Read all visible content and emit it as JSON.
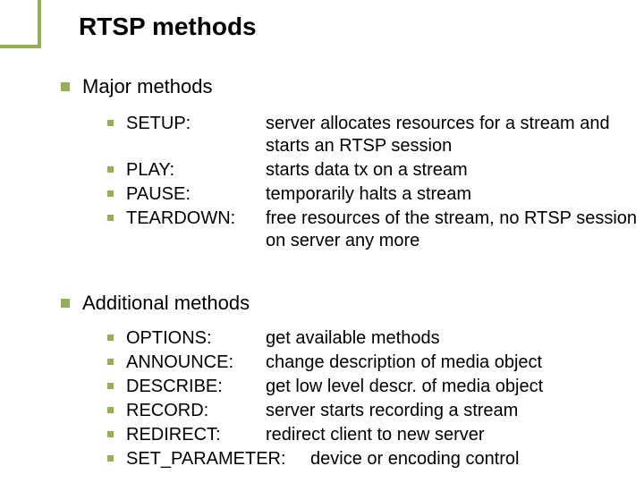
{
  "title": "RTSP methods",
  "sections": {
    "major": {
      "heading": "Major methods",
      "items": [
        {
          "term": "SETUP:",
          "desc": "server allocates resources for a stream and starts an RTSP session"
        },
        {
          "term": "PLAY:",
          "desc": "starts data tx on a stream"
        },
        {
          "term": "PAUSE:",
          "desc": "temporarily halts a stream"
        },
        {
          "term": "TEARDOWN:",
          "desc": "free resources of the stream, no RTSP session on server any more"
        }
      ]
    },
    "additional": {
      "heading": "Additional methods",
      "items": [
        {
          "term": "OPTIONS:",
          "desc": "get available methods"
        },
        {
          "term": "ANNOUNCE:",
          "desc": "change description of media object"
        },
        {
          "term": "DESCRIBE:",
          "desc": "get low level descr. of media object"
        },
        {
          "term": "RECORD:",
          "desc": "server starts recording a stream"
        },
        {
          "term": "REDIRECT:",
          "desc": "redirect client to new server"
        },
        {
          "term": "SET_PARAMETER:",
          "desc": "device or encoding control"
        }
      ]
    }
  }
}
